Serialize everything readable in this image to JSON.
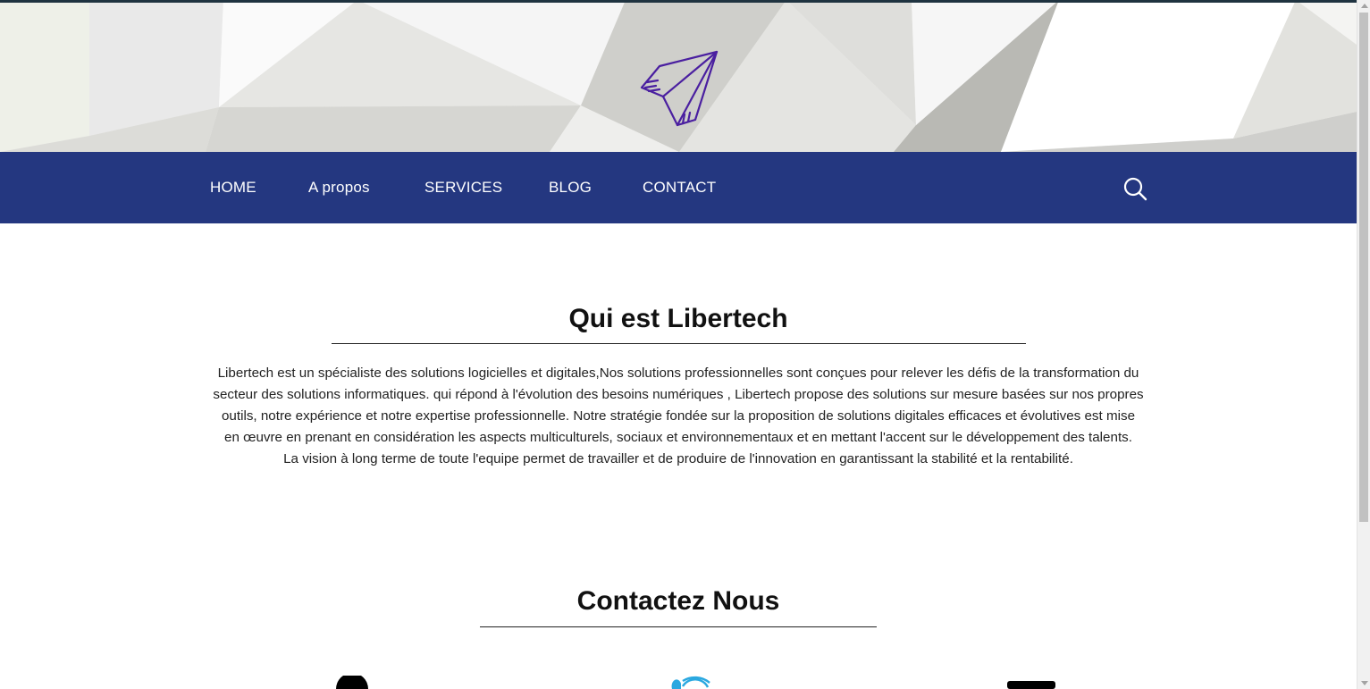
{
  "header": {
    "logo_icon": "paper-plane-icon",
    "logo_color": "#4a1fa0"
  },
  "nav": {
    "background": "#243780",
    "items": [
      {
        "label": "HOME"
      },
      {
        "label": "A propos"
      },
      {
        "label": "SERVICES"
      },
      {
        "label": "BLOG"
      },
      {
        "label": "CONTACT"
      }
    ],
    "search_icon": "search-icon"
  },
  "about": {
    "title": "Qui est Libertech",
    "lines": [
      "Libertech est un spécialiste des solutions logicielles et digitales,Nos solutions professionnelles sont conçues pour relever les défis de la transformation du",
      "secteur des solutions informatiques. qui répond à l'évolution des besoins numériques , Libertech propose des solutions sur mesure basées sur nos propres",
      "outils, notre expérience et notre expertise professionnelle. Notre stratégie fondée sur la proposition de solutions digitales efficaces et évolutives est mise",
      "en œuvre en prenant en considération les aspects multiculturels, sociaux et environnementaux et en mettant l'accent sur le développement des talents.",
      "La vision à long terme de toute l'equipe permet de travailler et de produire de l'innovation en garantissant la stabilité et la rentabilité."
    ]
  },
  "contact": {
    "title": "Contactez Nous",
    "icons": [
      "phone-icon",
      "wifi-icon",
      "mail-icon"
    ],
    "wifi_color": "#2aa8e0"
  }
}
